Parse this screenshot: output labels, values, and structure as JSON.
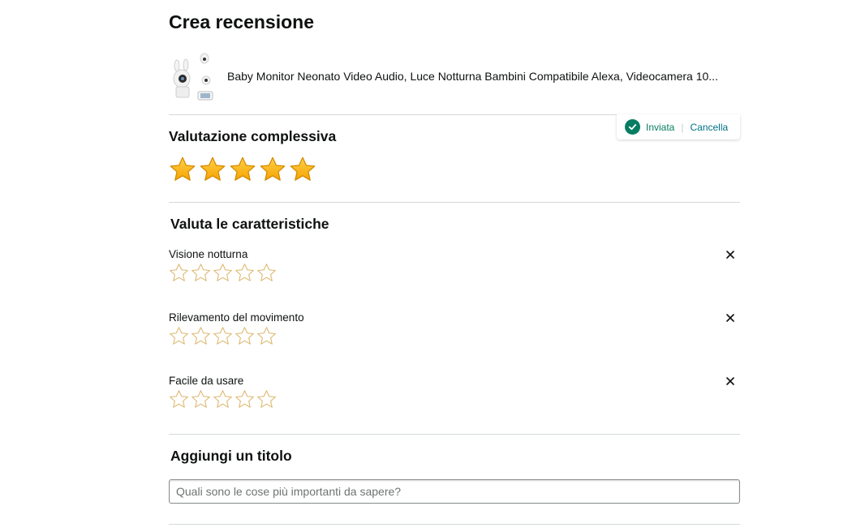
{
  "page": {
    "title": "Crea recensione"
  },
  "product": {
    "name": "Baby Monitor Neonato Video Audio, Luce Notturna Bambini Compatibile Alexa, Videocamera 10..."
  },
  "status": {
    "sent_label": "Inviata",
    "separator": "|",
    "cancel_label": "Cancella"
  },
  "overall": {
    "title": "Valutazione complessiva",
    "rating": 5,
    "max": 5
  },
  "features": {
    "title": "Valuta le caratteristiche",
    "items": [
      {
        "label": "Visione notturna",
        "rating": 0
      },
      {
        "label": "Rilevamento del movimento",
        "rating": 0
      },
      {
        "label": "Facile da usare",
        "rating": 0
      }
    ]
  },
  "headline": {
    "title": "Aggiungi un titolo",
    "placeholder": "Quali sono le cose più importanti da sapere?",
    "value": ""
  },
  "colors": {
    "star_filled": "#ffb900",
    "star_outline": "#dcb66b",
    "success": "#067d62",
    "link": "#007185"
  }
}
